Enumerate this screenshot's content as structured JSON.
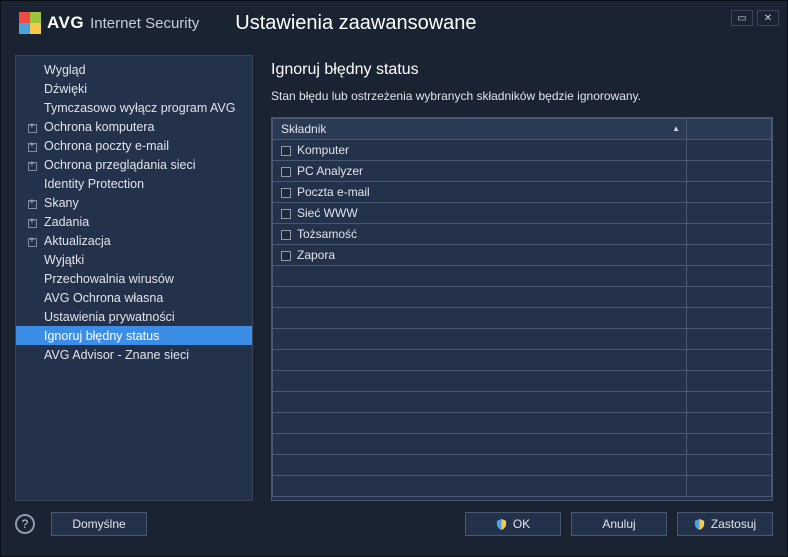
{
  "header": {
    "brand": "AVG",
    "product": "Internet Security",
    "title": "Ustawienia zaawansowane"
  },
  "sidebar": {
    "items": [
      {
        "label": "Wygląd",
        "expand": false
      },
      {
        "label": "Dźwięki",
        "expand": false
      },
      {
        "label": "Tymczasowo wyłącz program AVG",
        "expand": false
      },
      {
        "label": "Ochrona komputera",
        "expand": true
      },
      {
        "label": "Ochrona poczty e-mail",
        "expand": true
      },
      {
        "label": "Ochrona przeglądania sieci",
        "expand": true
      },
      {
        "label": "Identity Protection",
        "expand": false
      },
      {
        "label": "Skany",
        "expand": true
      },
      {
        "label": "Zadania",
        "expand": true
      },
      {
        "label": "Aktualizacja",
        "expand": true
      },
      {
        "label": "Wyjątki",
        "expand": false
      },
      {
        "label": "Przechowalnia wirusów",
        "expand": false
      },
      {
        "label": "AVG Ochrona własna",
        "expand": false
      },
      {
        "label": "Ustawienia prywatności",
        "expand": false
      },
      {
        "label": "Ignoruj błędny status",
        "expand": false,
        "selected": true
      },
      {
        "label": "AVG Advisor - Znane sieci",
        "expand": false
      }
    ]
  },
  "panel": {
    "title": "Ignoruj błędny status",
    "description": "Stan błędu lub ostrzeżenia wybranych składników będzie ignorowany.",
    "columnHeader": "Składnik",
    "rows": [
      {
        "label": "Komputer"
      },
      {
        "label": "PC Analyzer"
      },
      {
        "label": "Poczta e-mail"
      },
      {
        "label": "Sieć WWW"
      },
      {
        "label": "Tożsamość"
      },
      {
        "label": "Zapora"
      }
    ]
  },
  "footer": {
    "defaults": "Domyślne",
    "ok": "OK",
    "cancel": "Anuluj",
    "apply": "Zastosuj"
  }
}
